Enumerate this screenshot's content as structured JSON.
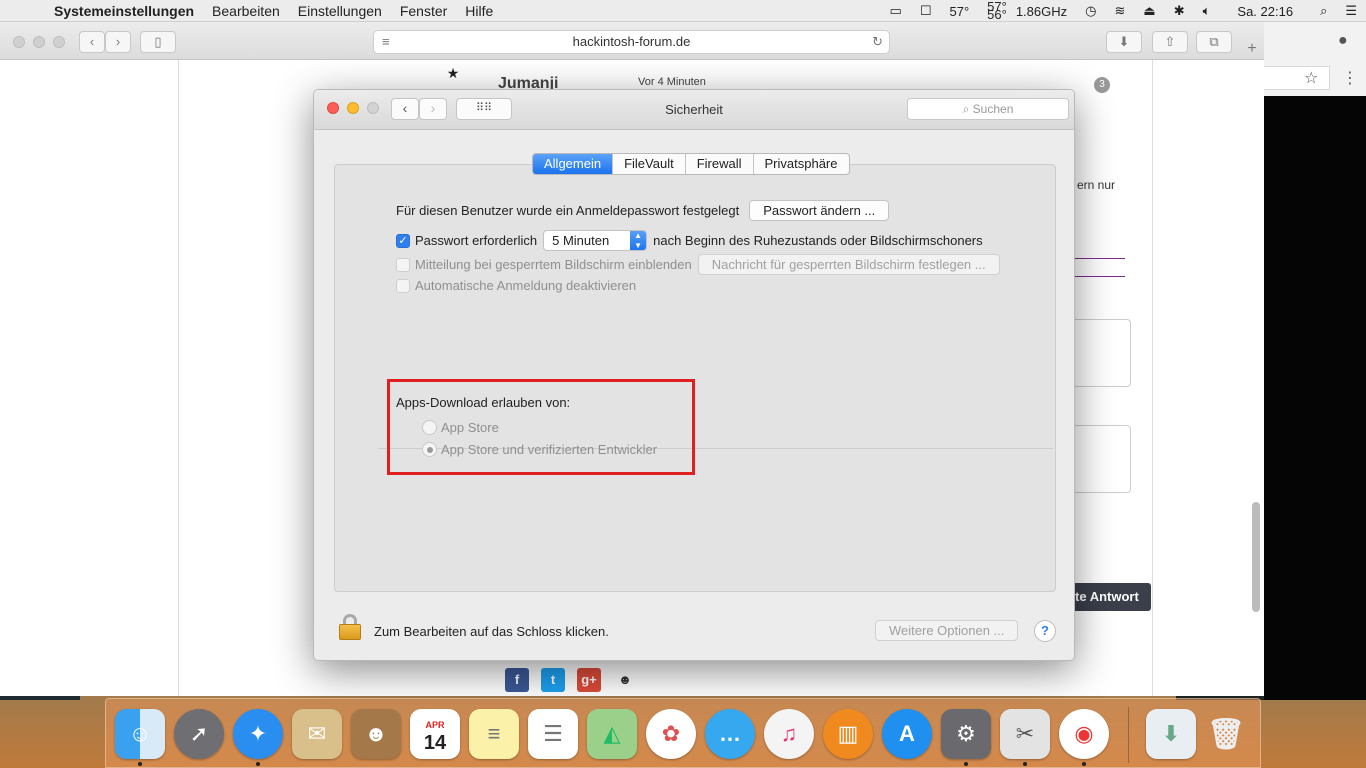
{
  "menubar": {
    "apple": "",
    "app_name": "Systemeinstellungen",
    "items": [
      "Bearbeiten",
      "Einstellungen",
      "Fenster",
      "Hilfe"
    ],
    "temp_main": "57°",
    "temp_a": "57°",
    "temp_b": "56°",
    "cpu": "1.86GHz",
    "clock": "Sa. 22:16"
  },
  "safari": {
    "url": "hackintosh-forum.de"
  },
  "webpage": {
    "title": "Jumanji",
    "time": "Vor 4 Minuten",
    "badge": "3",
    "partial_text": "ern nur",
    "answer_button": "te Antwort"
  },
  "prefs": {
    "title": "Sicherheit",
    "search_placeholder": "Suchen",
    "tabs": [
      {
        "label": "Allgemein",
        "active": true
      },
      {
        "label": "FileVault",
        "active": false
      },
      {
        "label": "Firewall",
        "active": false
      },
      {
        "label": "Privatsphäre",
        "active": false
      }
    ],
    "password_text": "Für diesen Benutzer wurde ein Anmeldepasswort festgelegt",
    "change_password_button": "Passwort ändern ...",
    "require_password_label": "Passwort erforderlich",
    "require_password_select": "5 Minuten",
    "require_password_suffix": "nach Beginn des Ruhezustands oder Bildschirmschoners",
    "lock_message_label": "Mitteilung bei gesperrtem Bildschirm einblenden",
    "lock_message_button": "Nachricht für gesperrten Bildschirm festlegen ...",
    "auto_login_label": "Automatische Anmeldung deaktivieren",
    "apps_download_label": "Apps-Download erlauben von:",
    "radio_app_store": "App Store",
    "radio_app_store_dev": "App Store und verifizierten Entwickler",
    "lock_text": "Zum Bearbeiten auf das Schloss klicken.",
    "more_options_button": "Weitere Optionen ...",
    "help": "?"
  },
  "dock": {
    "calendar_month": "APR",
    "calendar_day": "14"
  }
}
